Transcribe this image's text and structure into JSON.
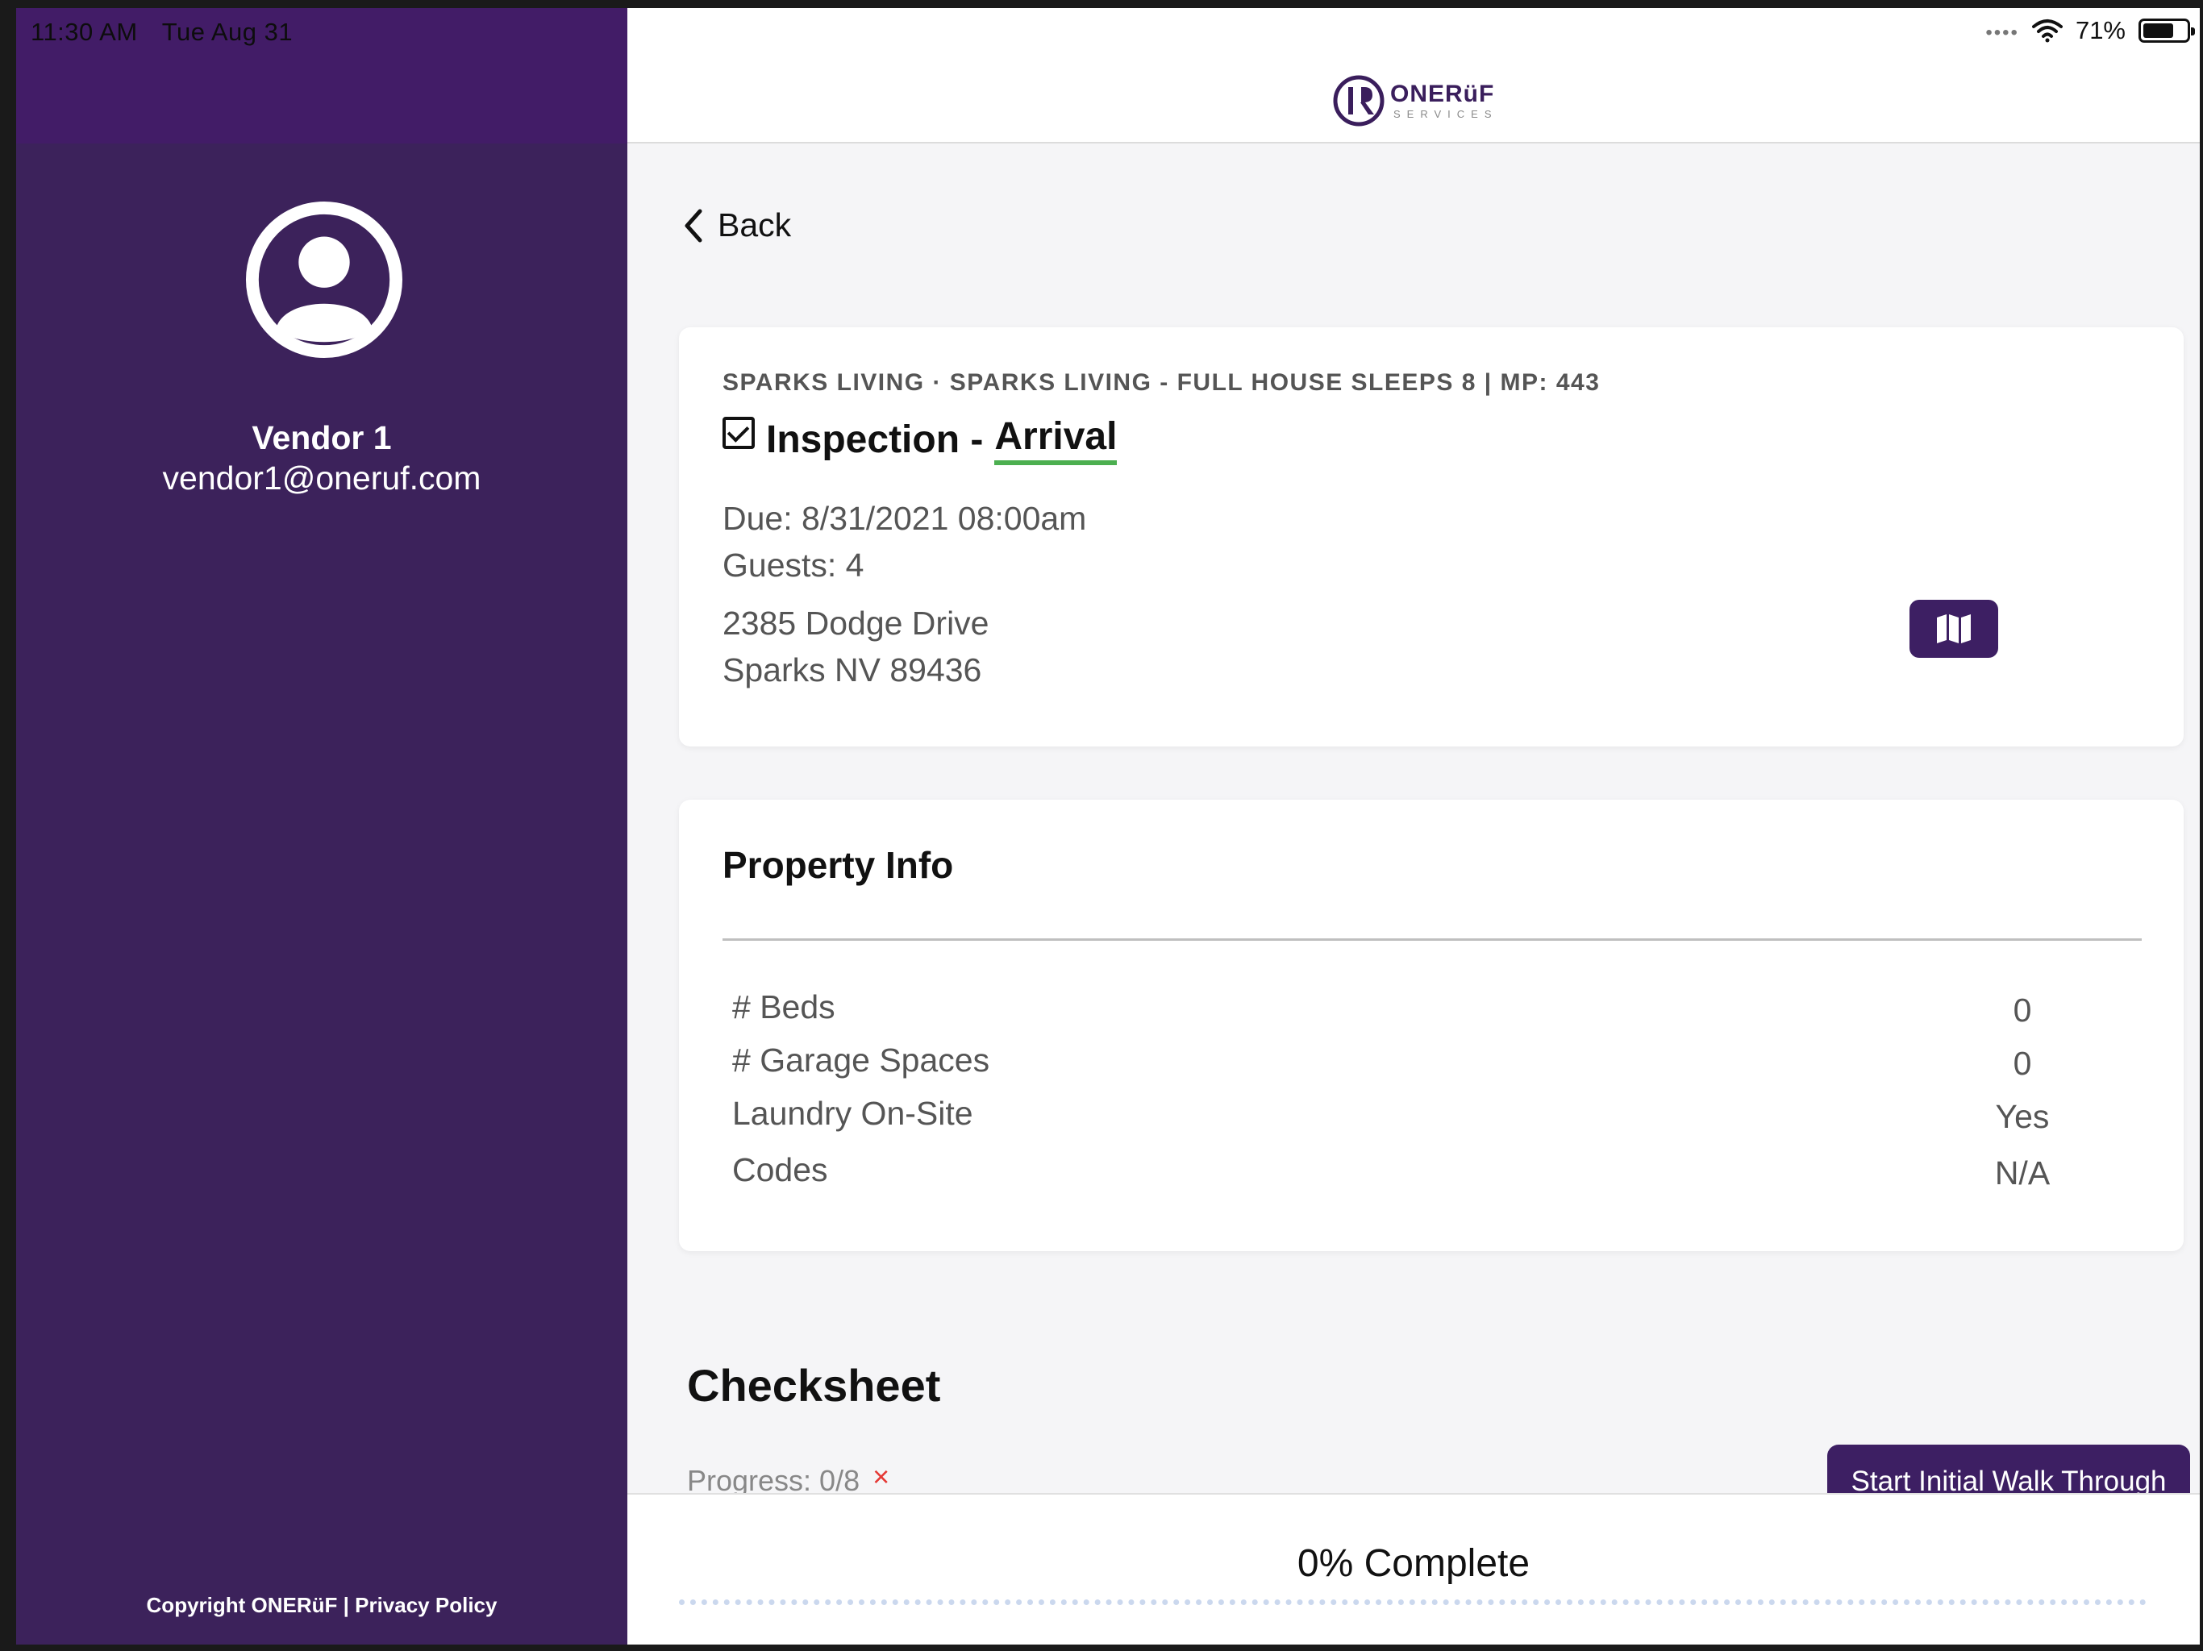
{
  "status_bar": {
    "time": "11:30 AM",
    "date": "Tue Aug 31",
    "battery_percent": "71%",
    "battery_level": 0.71
  },
  "sidebar": {
    "user_name": "Vendor 1",
    "user_email": "vendor1@oneruf.com",
    "footer": "Copyright ONERüF | Privacy Policy"
  },
  "header": {
    "logo_title": "ONERüF",
    "logo_subtitle": "SERVICES"
  },
  "nav": {
    "back_label": "Back"
  },
  "task": {
    "subtitle": "SPARKS LIVING · SPARKS LIVING - FULL HOUSE SLEEPS 8 | MP: 443",
    "title_prefix": "Inspection - ",
    "title_highlight": "Arrival",
    "due": "Due: 8/31/2021 08:00am",
    "guests": "Guests: 4",
    "address_line1": "2385 Dodge Drive",
    "address_line2": "Sparks NV 89436"
  },
  "property_info": {
    "title": "Property Info",
    "rows": [
      {
        "label": "# Beds",
        "value": "0"
      },
      {
        "label": "# Garage Spaces",
        "value": "0"
      },
      {
        "label": "Laundry On-Site",
        "value": "Yes"
      },
      {
        "label": "Codes",
        "value": "N/A"
      }
    ]
  },
  "checksheet": {
    "title": "Checksheet",
    "progress": "Progress: 0/8",
    "progress_mark": "×",
    "start_button": "Start Initial Walk Through"
  },
  "footer_bar": {
    "complete_text": "0% Complete"
  },
  "colors": {
    "sidebar_bg": "#3c225b",
    "accent": "#3d1f63",
    "highlight_underline": "#4caf50",
    "error": "#e53935"
  }
}
